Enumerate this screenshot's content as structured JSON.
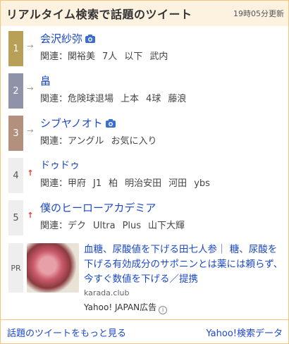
{
  "header": {
    "title": "リアルタイム検索で話題のツイート",
    "updated": "19時05分更新"
  },
  "ranking": [
    {
      "rank": "1",
      "trend": "→",
      "title": "会沢紗弥",
      "photo": true,
      "related_label": "関連：",
      "related": [
        "関裕美",
        "7人",
        "以下",
        "武内"
      ]
    },
    {
      "rank": "2",
      "trend": "→",
      "title": "畠",
      "photo": false,
      "related_label": "関連：",
      "related": [
        "危険球退場",
        "上本",
        "4球",
        "藤浪"
      ]
    },
    {
      "rank": "3",
      "trend": "→",
      "title": "シブヤノオト",
      "photo": true,
      "related_label": "関連：",
      "related": [
        "アングル",
        "お気に入り"
      ]
    },
    {
      "rank": "4",
      "trend": "↑",
      "title": "ドゥドゥ",
      "photo": false,
      "related_label": "関連：",
      "related": [
        "甲府",
        "J1",
        "柏",
        "明治安田",
        "河田",
        "ybs"
      ]
    },
    {
      "rank": "5",
      "trend": "↑",
      "title": "僕のヒーローアカデミア",
      "photo": false,
      "related_label": "関連：",
      "related": [
        "デク",
        "Ultra",
        "Plus",
        "山下大輝"
      ]
    }
  ],
  "ad": {
    "badge": "PR",
    "text": "血糖、尿酸値を下げる田七人参｜ 糖、尿酸を下げる有効成分のサポニンとは薬には頼らず、今すぐ数値を下げる／提携",
    "domain": "karada.club",
    "sponsor": "Yahoo! JAPAN広告"
  },
  "footer": {
    "more_link": "話題のツイートをもっと見る",
    "source_link": "Yahoo!検索データ"
  },
  "colors": {
    "link": "#1b48c9",
    "border": "#f3c47a",
    "header_bg": "#fdf2e0",
    "rank1": "#b8a058",
    "rank2": "#8e93aa",
    "rank3": "#b38f7e",
    "up": "#e83a2a"
  },
  "icons": {
    "photo": "camera-icon",
    "same": "arrow-right-icon",
    "up": "arrow-up-icon",
    "info": "info-icon"
  }
}
